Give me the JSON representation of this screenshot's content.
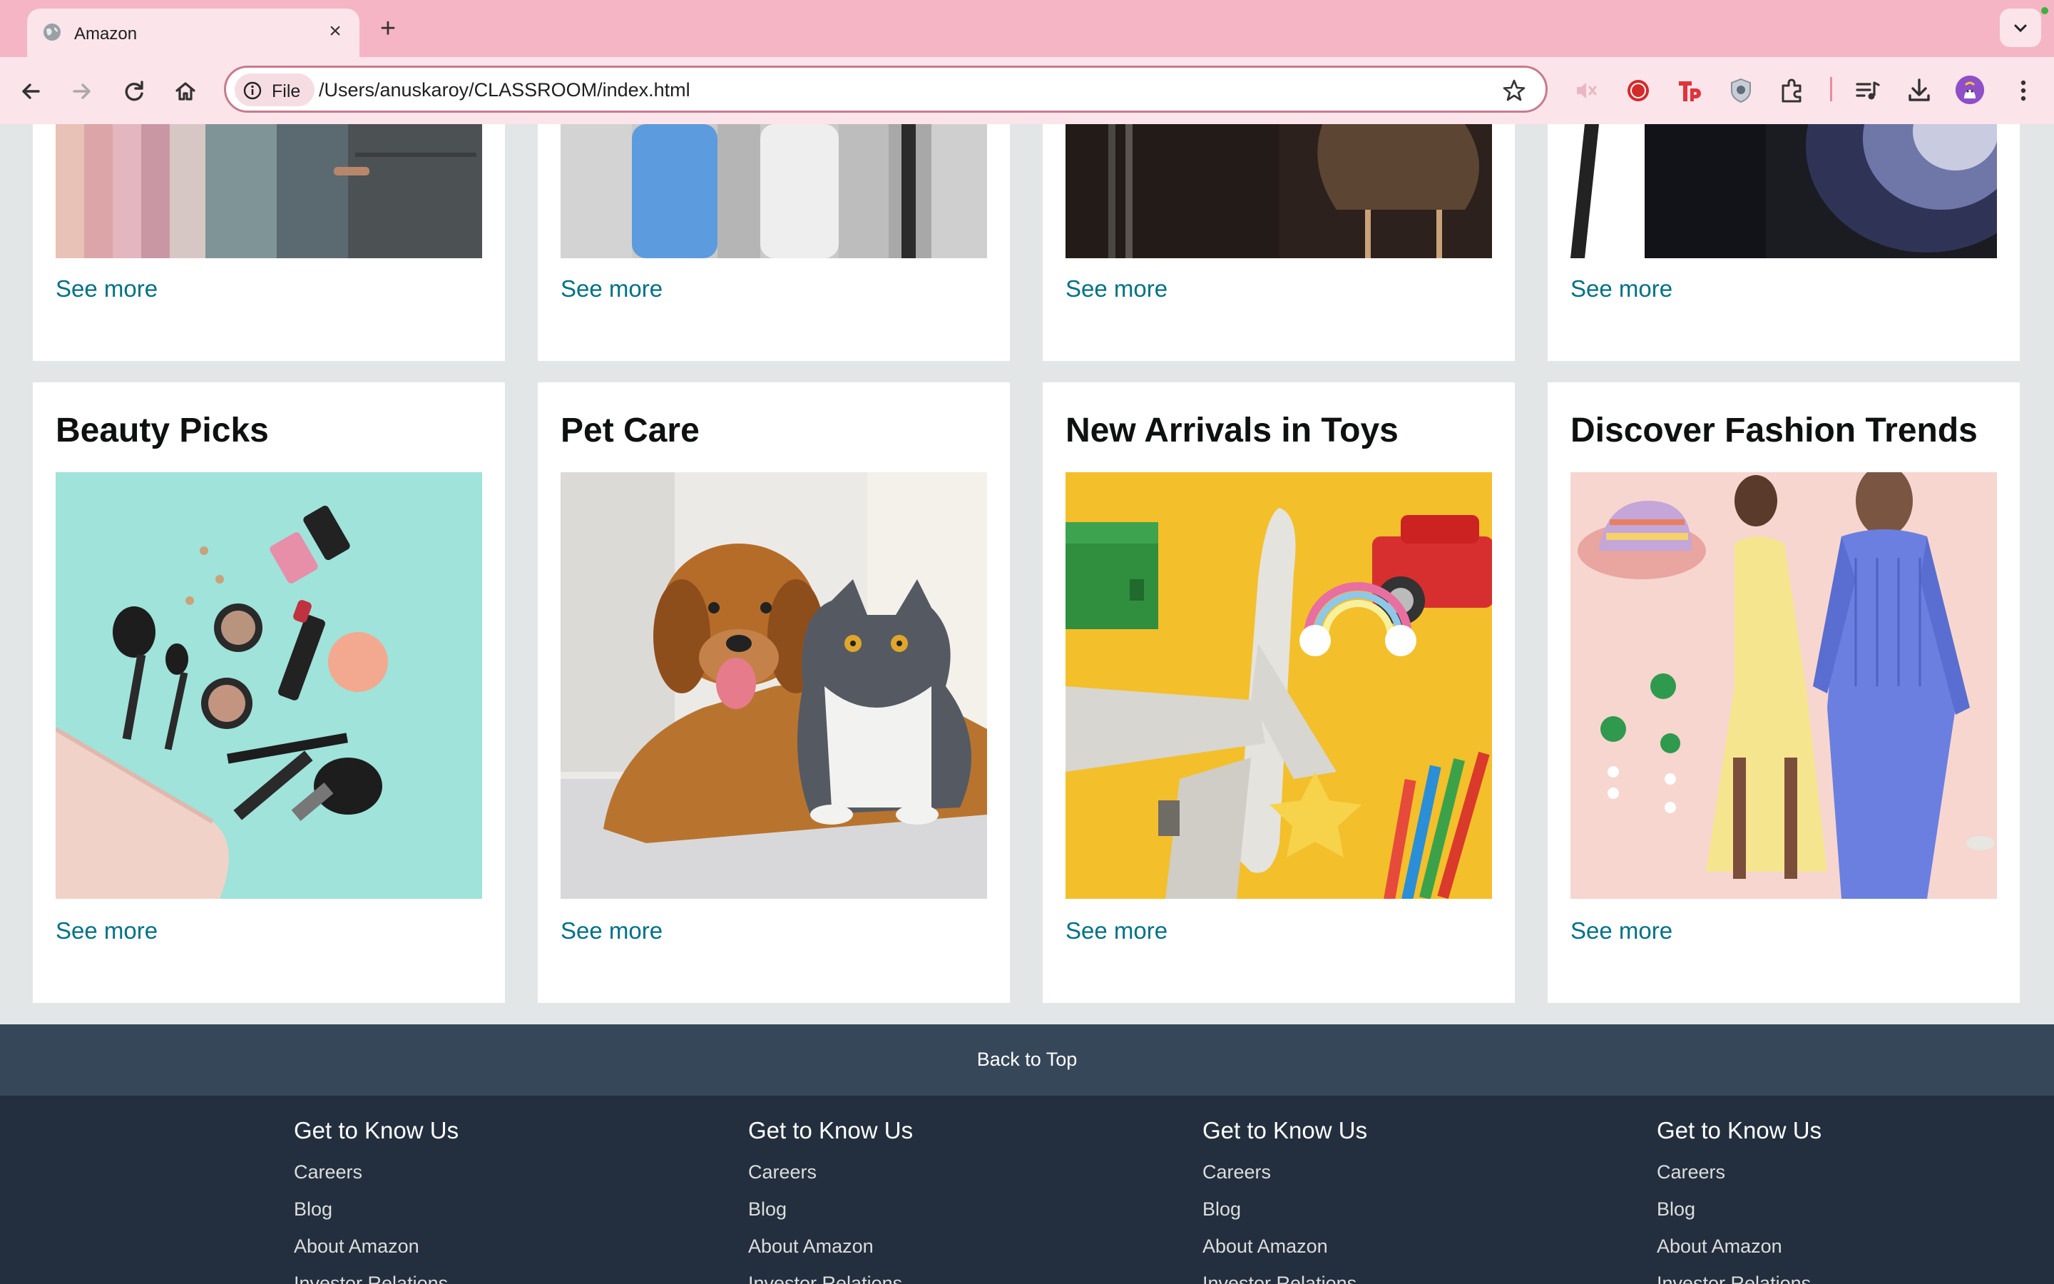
{
  "browser": {
    "tab_title": "Amazon",
    "close_symbol": "×",
    "new_tab_symbol": "+",
    "chip_label": "File",
    "url": "/Users/anuskaroy/CLASSROOM/index.html",
    "icons": [
      "back-icon",
      "forward-icon",
      "reload-icon",
      "home-icon",
      "info-icon",
      "star-icon",
      "muted-icon",
      "record-icon",
      "tp-extension-icon",
      "shield-extension-icon",
      "extensions-icon",
      "media-controls-icon",
      "download-icon",
      "profile-avatar",
      "menu-icon"
    ]
  },
  "top_cards": [
    {
      "link": "See more",
      "image": "fabric-swatches"
    },
    {
      "link": "See more",
      "image": "kitchen-appliances"
    },
    {
      "link": "See more",
      "image": "furniture-chair"
    },
    {
      "link": "See more",
      "image": "samsung-phone"
    }
  ],
  "cards": [
    {
      "title": "Beauty Picks",
      "link": "See more",
      "image": "makeup-flatlay"
    },
    {
      "title": "Pet Care",
      "link": "See more",
      "image": "dog-and-cat"
    },
    {
      "title": "New Arrivals in Toys",
      "link": "See more",
      "image": "toy-plane-pencils"
    },
    {
      "title": "Discover Fashion Trends",
      "link": "See more",
      "image": "fashion-models"
    }
  ],
  "back_to_top": "Back to Top",
  "footer": {
    "columns": [
      {
        "heading": "Get to Know Us",
        "links": [
          "Careers",
          "Blog",
          "About Amazon",
          "Investor Relations"
        ]
      },
      {
        "heading": "Get to Know Us",
        "links": [
          "Careers",
          "Blog",
          "About Amazon",
          "Investor Relations"
        ]
      },
      {
        "heading": "Get to Know Us",
        "links": [
          "Careers",
          "Blog",
          "About Amazon",
          "Investor Relations"
        ]
      },
      {
        "heading": "Get to Know Us",
        "links": [
          "Careers",
          "Blog",
          "About Amazon",
          "Investor Relations"
        ]
      }
    ]
  },
  "colors": {
    "tabbar": "#f5b5c4",
    "toolbar": "#fbe4ea",
    "link": "#007185",
    "back_to_top": "#37475a",
    "footer": "#232f3e",
    "page_bg": "#e3e6e6"
  }
}
